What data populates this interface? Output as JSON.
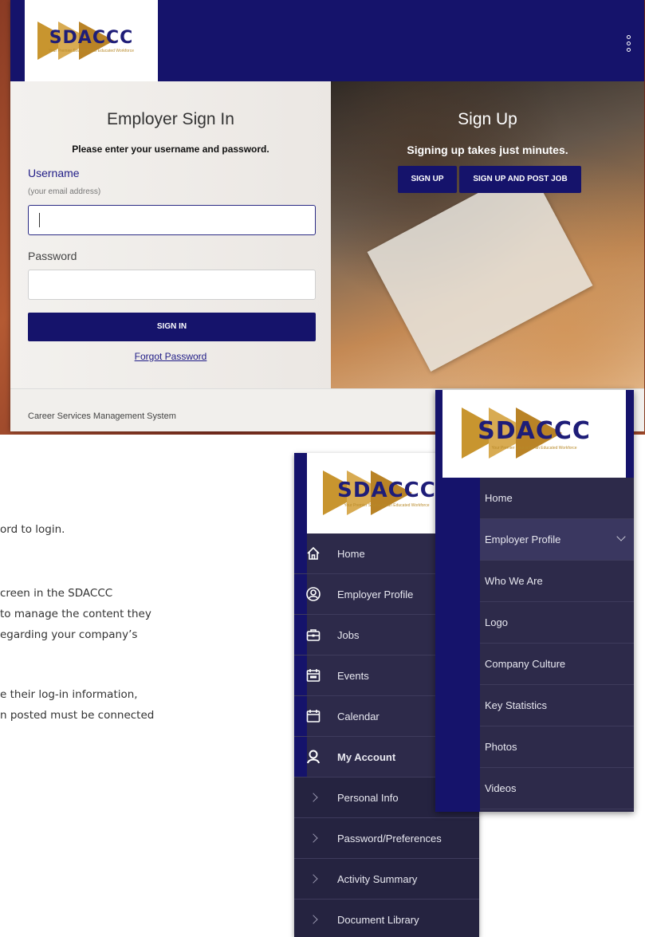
{
  "brand": {
    "logo_word": "SDACCC",
    "logo_tagline": "Your Premier Source for an Educated Workforce",
    "primary_color": "#15136b",
    "accent_color": "#c8952f"
  },
  "login": {
    "signin_title": "Employer Sign In",
    "signin_subtitle": "Please enter your username and password.",
    "username_label": "Username",
    "username_hint": "(your email address)",
    "username_value": "",
    "password_label": "Password",
    "password_value": "",
    "signin_button": "SIGN IN",
    "forgot_link": "Forgot Password",
    "signup_title": "Sign Up",
    "signup_subtitle": "Signing up takes just minutes.",
    "signup_button": "SIGN UP",
    "signup_post_button": "SIGN UP AND POST JOB",
    "footer_text": "Career Services Management System",
    "menu_icon": "kebab-menu-icon"
  },
  "document": {
    "lines": [
      "ord to login.",
      "creen in the SDACCC",
      "to manage the content they",
      "egarding your company’s",
      "e their log-in information,",
      "n posted must be connected"
    ]
  },
  "menu_left": {
    "items": [
      {
        "label": "Home",
        "icon": "home-icon"
      },
      {
        "label": "Employer Profile",
        "icon": "profile-icon"
      },
      {
        "label": "Jobs",
        "icon": "briefcase-icon"
      },
      {
        "label": "Events",
        "icon": "events-calendar-icon"
      },
      {
        "label": "Calendar",
        "icon": "calendar-icon"
      },
      {
        "label": "My Account",
        "icon": "account-icon"
      }
    ],
    "subitems": [
      {
        "label": "Personal Info"
      },
      {
        "label": "Password/Preferences"
      },
      {
        "label": "Activity Summary"
      },
      {
        "label": "Document Library"
      }
    ]
  },
  "menu_right": {
    "items": [
      {
        "label": "Home"
      },
      {
        "label": "Employer Profile"
      },
      {
        "label": "Who We Are"
      },
      {
        "label": "Logo"
      },
      {
        "label": "Company Culture"
      },
      {
        "label": "Key Statistics"
      },
      {
        "label": "Photos"
      },
      {
        "label": "Videos"
      }
    ]
  }
}
